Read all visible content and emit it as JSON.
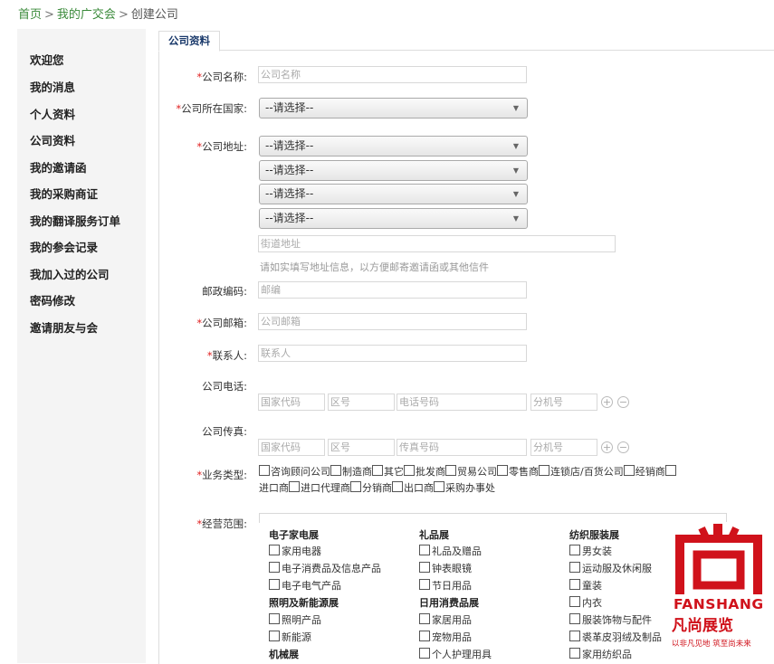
{
  "breadcrumb": {
    "home": "首页",
    "my_expo": "我的广交会",
    "current": "创建公司",
    "sep": ">"
  },
  "sidebar": {
    "items": [
      {
        "label": "欢迎您"
      },
      {
        "label": "我的消息"
      },
      {
        "label": "个人资料"
      },
      {
        "label": "公司资料"
      },
      {
        "label": "我的邀请函"
      },
      {
        "label": "我的采购商证"
      },
      {
        "label": "我的翻译服务订单"
      },
      {
        "label": "我的参会记录"
      },
      {
        "label": "我加入过的公司"
      },
      {
        "label": "密码修改"
      },
      {
        "label": "邀请朋友与会"
      }
    ]
  },
  "tab": {
    "label": "公司资料"
  },
  "form": {
    "required_mark": "*",
    "company_name": {
      "label": "公司名称:",
      "placeholder": "公司名称"
    },
    "country": {
      "label": "公司所在国家:",
      "value": "--请选择--"
    },
    "address": {
      "label": "公司地址:",
      "selects": [
        "--请选择--",
        "--请选择--",
        "--请选择--",
        "--请选择--"
      ],
      "street_placeholder": "街道地址",
      "hint": "请如实填写地址信息，以方便邮寄邀请函或其他信件"
    },
    "postcode": {
      "label": "邮政编码:",
      "placeholder": "邮编"
    },
    "email": {
      "label": "公司邮箱:",
      "placeholder": "公司邮箱"
    },
    "contact": {
      "label": "联系人:",
      "placeholder": "联系人"
    },
    "phone": {
      "label": "公司电话:",
      "country_code": "国家代码",
      "area_code": "区号",
      "number": "电话号码",
      "ext": "分机号"
    },
    "fax": {
      "label": "公司传真:",
      "country_code": "国家代码",
      "area_code": "区号",
      "number": "传真号码",
      "ext": "分机号"
    },
    "plus": "+",
    "minus": "−",
    "business_type": {
      "label": "业务类型:",
      "options": [
        "咨询顾问公司",
        "制造商",
        "其它",
        "批发商",
        "贸易公司",
        "零售商",
        "连锁店/百货公司",
        "经销商",
        "进口商",
        "进口代理商",
        "分销商",
        "出口商",
        "采购办事处"
      ]
    },
    "scope": {
      "label": "经营范围:",
      "columns": [
        {
          "groups": [
            {
              "title": "电子家电展",
              "items": [
                "家用电器",
                "电子消费品及信息产品",
                "电子电气产品"
              ]
            },
            {
              "title": "照明及新能源展",
              "items": [
                "照明产品",
                "新能源"
              ]
            },
            {
              "title": "机械展",
              "items": []
            }
          ]
        },
        {
          "groups": [
            {
              "title": "礼品展",
              "items": [
                "礼品及赠品",
                "钟表眼镜",
                "节日用品"
              ]
            },
            {
              "title": "日用消费品展",
              "items": [
                "家居用品",
                "宠物用品",
                "个人护理用具"
              ]
            }
          ]
        },
        {
          "groups": [
            {
              "title": "纺织服装展",
              "items": [
                "男女装",
                "运动服及休闲服",
                "童装",
                "内衣",
                "服装饰物与配件",
                "裘革皮羽绒及制品",
                "家用纺织品"
              ]
            }
          ]
        }
      ]
    }
  },
  "watermark": {
    "brand": "FANSHANG",
    "name_zh": "凡尚展览",
    "slogan": "以非凡见地 筑至尚未来",
    "color": "#d0121b"
  },
  "colors": {
    "link": "#3a8a3a",
    "required": "#e02020",
    "tab_text": "#1b3a6b"
  }
}
